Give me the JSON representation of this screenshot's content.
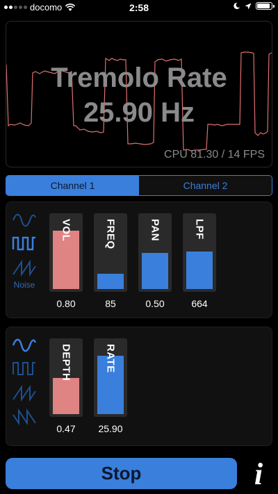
{
  "status": {
    "carrier": "docomo",
    "time": "2:58"
  },
  "scope": {
    "title_line1": "Tremolo Rate",
    "title_line2": "25.90 Hz",
    "cpu": "CPU 81.30 / 14 FPS",
    "wave_color": "#e07070"
  },
  "tabs": [
    {
      "label": "Channel 1",
      "active": true
    },
    {
      "label": "Channel 2",
      "active": false
    }
  ],
  "panel1": {
    "waveforms": [
      "sine-wave-icon",
      "square-wave-icon",
      "sawtooth-wave-icon"
    ],
    "selected": "square-wave-icon",
    "noise_label": "Noise",
    "sliders": [
      {
        "label": "VOL",
        "value": "0.80",
        "level": 0.8,
        "color": "#e08383"
      },
      {
        "label": "FREQ",
        "value": "85",
        "level": 0.22,
        "color": "#3a7fdc"
      },
      {
        "label": "PAN",
        "value": "0.50",
        "level": 0.5,
        "color": "#3a7fdc"
      },
      {
        "label": "LPF",
        "value": "664",
        "level": 0.52,
        "color": "#3a7fdc"
      }
    ]
  },
  "panel2": {
    "waveforms": [
      "sine-wave-icon",
      "square-wave-icon",
      "sawtooth-wave-icon",
      "reverse-sawtooth-wave-icon"
    ],
    "selected": "sine-wave-icon",
    "sliders": [
      {
        "label": "DEPTH",
        "value": "0.47",
        "level": 0.5,
        "color": "#e08383"
      },
      {
        "label": "RATE",
        "value": "25.90",
        "level": 0.8,
        "color": "#3a7fdc"
      }
    ]
  },
  "controls": {
    "stop_label": "Stop",
    "info_label": "i"
  },
  "colors": {
    "accent": "#3a7fdc",
    "dim_accent": "#1e4f8f",
    "pink": "#e08383"
  }
}
